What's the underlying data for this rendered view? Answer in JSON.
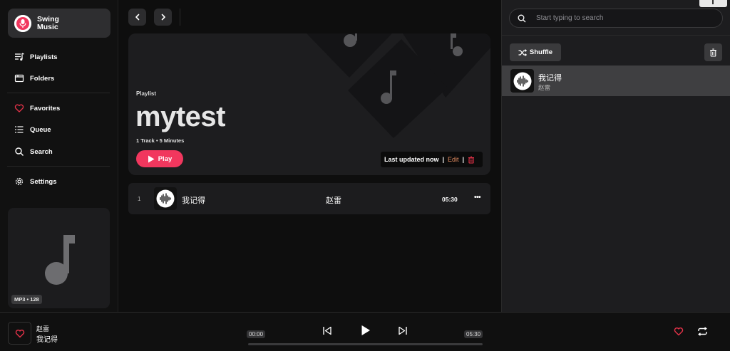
{
  "app": {
    "name": "Swing Music"
  },
  "sidebar": {
    "items": [
      {
        "label": "Playlists",
        "icon": "playlist-icon"
      },
      {
        "label": "Folders",
        "icon": "folder-icon"
      },
      {
        "label": "Favorites",
        "icon": "heart-icon"
      },
      {
        "label": "Queue",
        "icon": "queue-icon"
      },
      {
        "label": "Search",
        "icon": "search-icon"
      },
      {
        "label": "Settings",
        "icon": "gear-icon"
      }
    ],
    "now_playing_badge": "MP3 • 128"
  },
  "playlist": {
    "type_label": "Playlist",
    "name": "mytest",
    "meta": "1 Track • 5 Minutes",
    "play_label": "Play",
    "last_updated": "Last updated now",
    "edit_label": "Edit",
    "tracks": [
      {
        "index": "1",
        "title": "我记得",
        "artist": "赵雷",
        "duration": "05:30"
      }
    ]
  },
  "right_panel": {
    "search_placeholder": "Start typing to search",
    "shuffle_label": "Shuffle",
    "queue": [
      {
        "title": "我记得",
        "artist": "赵雷"
      }
    ]
  },
  "player": {
    "artist": "赵雷",
    "title": "我记得",
    "current_time": "00:00",
    "total_time": "05:30",
    "progress": 0
  },
  "colors": {
    "accent": "#f1375e",
    "favorite": "#e8334a",
    "edit": "#e38d62"
  }
}
